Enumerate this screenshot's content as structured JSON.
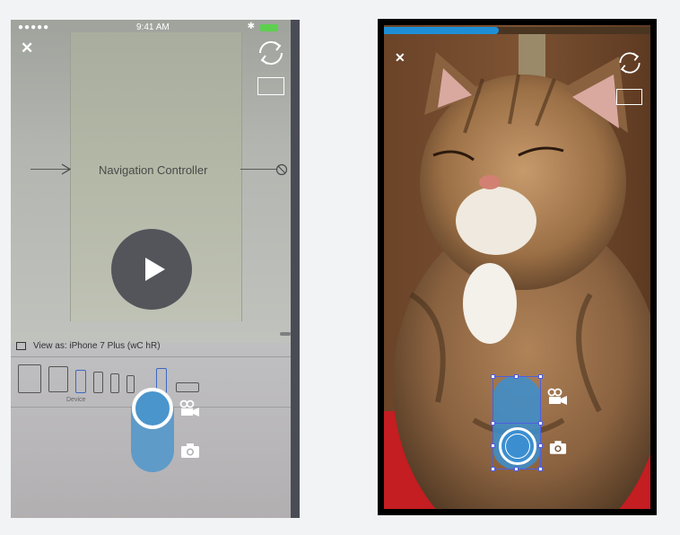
{
  "left_phone": {
    "statusbar": {
      "signal": "●●●●●",
      "time": "9:41 AM",
      "bluetooth": "✱"
    },
    "close_label": "✕",
    "icons": [
      "close-icon",
      "flip-camera-icon",
      "aspect-frame-icon",
      "play-icon",
      "video-camera-icon",
      "photo-camera-icon"
    ],
    "scene_label": "Navigation Controller",
    "view_as_label": "View as: iPhone 7 Plus (wC hR)",
    "device_label": "Device",
    "colors": {
      "capsule": "#4a95cc",
      "play_bg": "#4a4c54"
    }
  },
  "right_phone": {
    "close_label": "✕",
    "progress": 0.43,
    "icons": [
      "close-icon",
      "flip-camera-icon",
      "aspect-frame-icon",
      "video-camera-icon",
      "photo-camera-icon",
      "shutter-button-icon"
    ],
    "colors": {
      "progress": "#1e8fd6",
      "capsule": "#3b8fd0",
      "selection": "#4d5fe0"
    }
  }
}
